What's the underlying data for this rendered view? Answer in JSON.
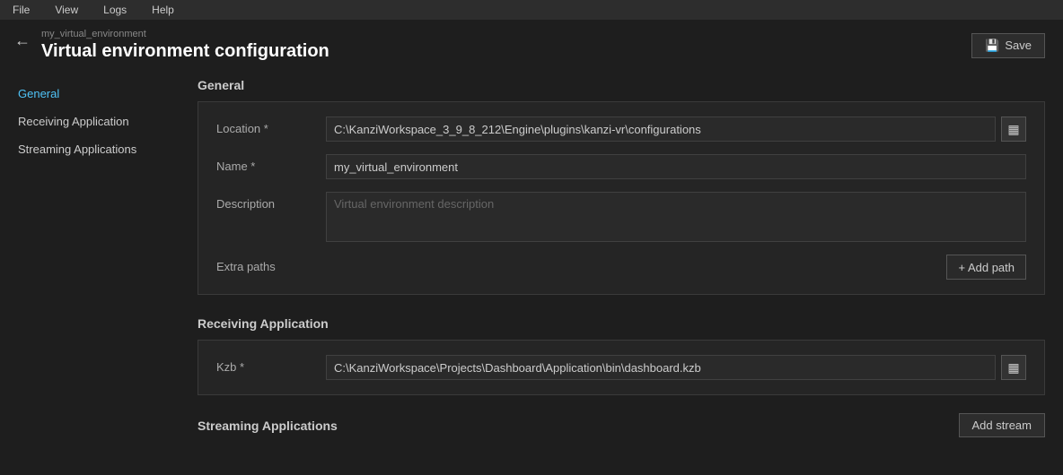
{
  "menubar": {
    "items": [
      "File",
      "View",
      "Logs",
      "Help"
    ]
  },
  "header": {
    "breadcrumb": "my_virtual_environment",
    "title": "Virtual environment configuration",
    "back_label": "←",
    "save_label": "Save",
    "save_icon": "💾"
  },
  "sidebar": {
    "items": [
      {
        "id": "general",
        "label": "General",
        "active": true
      },
      {
        "id": "receiving-application",
        "label": "Receiving Application",
        "active": false
      },
      {
        "id": "streaming-applications",
        "label": "Streaming Applications",
        "active": false
      }
    ]
  },
  "content": {
    "general_section_title": "General",
    "general_form": {
      "location_label": "Location *",
      "location_value": "C:\\KanziWorkspace_3_9_8_212\\Engine\\plugins\\kanzi-vr\\configurations",
      "name_label": "Name *",
      "name_value": "my_virtual_environment",
      "description_label": "Description",
      "description_placeholder": "Virtual environment description",
      "extra_paths_label": "Extra paths",
      "add_path_label": "+ Add path"
    },
    "receiving_section_title": "Receiving Application",
    "receiving_form": {
      "kzb_label": "Kzb *",
      "kzb_value": "C:\\KanziWorkspace\\Projects\\Dashboard\\Application\\bin\\dashboard.kzb"
    },
    "streaming_section_title": "Streaming Applications",
    "add_stream_label": "Add stream"
  }
}
